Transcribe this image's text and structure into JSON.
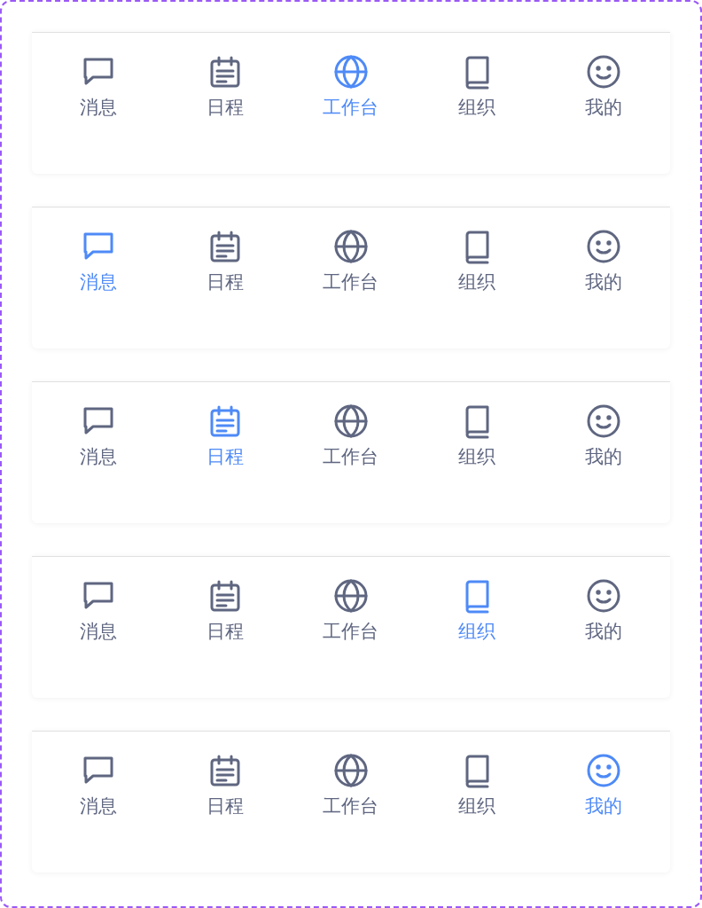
{
  "tab_bars": [
    {
      "tabs": [
        {
          "kind": "message",
          "label": "消息",
          "selected": false
        },
        {
          "kind": "calendar",
          "label": "日程",
          "selected": false
        },
        {
          "kind": "globe",
          "label": "工作台",
          "selected": true
        },
        {
          "kind": "book",
          "label": "组织",
          "selected": false
        },
        {
          "kind": "smile",
          "label": "我的",
          "selected": false
        }
      ]
    },
    {
      "tabs": [
        {
          "kind": "message",
          "label": "消息",
          "selected": true
        },
        {
          "kind": "calendar",
          "label": "日程",
          "selected": false
        },
        {
          "kind": "globe",
          "label": "工作台",
          "selected": false
        },
        {
          "kind": "book",
          "label": "组织",
          "selected": false
        },
        {
          "kind": "smile",
          "label": "我的",
          "selected": false
        }
      ]
    },
    {
      "tabs": [
        {
          "kind": "message",
          "label": "消息",
          "selected": false
        },
        {
          "kind": "calendar",
          "label": "日程",
          "selected": true
        },
        {
          "kind": "globe",
          "label": "工作台",
          "selected": false
        },
        {
          "kind": "book",
          "label": "组织",
          "selected": false
        },
        {
          "kind": "smile",
          "label": "我的",
          "selected": false
        }
      ]
    },
    {
      "tabs": [
        {
          "kind": "message",
          "label": "消息",
          "selected": false
        },
        {
          "kind": "calendar",
          "label": "日程",
          "selected": false
        },
        {
          "kind": "globe",
          "label": "工作台",
          "selected": false
        },
        {
          "kind": "book",
          "label": "组织",
          "selected": true
        },
        {
          "kind": "smile",
          "label": "我的",
          "selected": false
        }
      ]
    },
    {
      "tabs": [
        {
          "kind": "message",
          "label": "消息",
          "selected": false
        },
        {
          "kind": "calendar",
          "label": "日程",
          "selected": false
        },
        {
          "kind": "globe",
          "label": "工作台",
          "selected": false
        },
        {
          "kind": "book",
          "label": "组织",
          "selected": false
        },
        {
          "kind": "smile",
          "label": "我的",
          "selected": true
        }
      ]
    }
  ]
}
